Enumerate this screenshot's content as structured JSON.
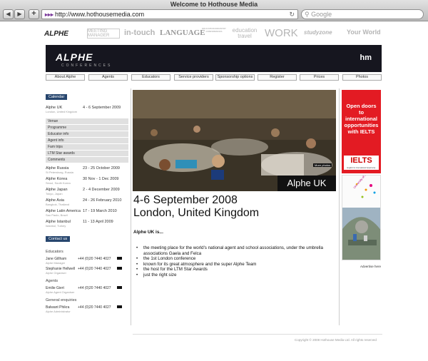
{
  "window": {
    "title": "Welcome to Hothouse Media"
  },
  "toolbar": {
    "back": "◀",
    "forward": "▶",
    "add": "+",
    "url": "http://www.hothousemedia.com",
    "search_placeholder": "Google",
    "reload": "↻"
  },
  "brands": [
    "ALPHE",
    "MEETING MANAGER",
    "in-touch",
    "LANGUAGE",
    "EDUCATION INDUSTRY CONFERENCES",
    "education travel",
    "WORK",
    "studyzone",
    "Your World"
  ],
  "banner": {
    "logo": "ALPHE",
    "sub": "CONFERENCES",
    "mark": "hm"
  },
  "menu": [
    "About Alphe",
    "Agents",
    "Educators",
    "Service providers",
    "Sponsorship options",
    "Register",
    "Prices",
    "Photos"
  ],
  "sidebar": {
    "calendar_tab": "Calendar",
    "current": {
      "name": "Alphe UK",
      "sub": "London, United Kingdom",
      "date": "4 - 6 September 2009"
    },
    "submenu": [
      "Venue",
      "Programme",
      "Educator info",
      "Agent info",
      "Fam trips",
      "LTM Star awards",
      "Comments"
    ],
    "events": [
      {
        "name": "Alphe Russia",
        "sub": "St Petersburg, Russia",
        "date": "23 - 25 October 2009"
      },
      {
        "name": "Alphe Korea",
        "sub": "Seoul, South Korea",
        "date": "30 Nov - 1 Dec 2009"
      },
      {
        "name": "Alphe Japan",
        "sub": "Tokyo, Japan",
        "date": "2 - 4 December 2009"
      },
      {
        "name": "Alphe Asia",
        "sub": "Bangkok, Thailand",
        "date": "24 - 26 February 2010"
      },
      {
        "name": "Alphe Latin America",
        "sub": "Sao Paulo, Brazil",
        "date": "17 - 19 March 2010"
      },
      {
        "name": "Alphe Istanbul",
        "sub": "Istanbul, Turkey",
        "date": "11 - 13 April 2009"
      }
    ],
    "contact_tab": "Contact us",
    "groups": [
      {
        "title": "Educators",
        "people": [
          {
            "name": "Jane Gillham",
            "role": "Alphe Manager",
            "phone": "+44 (0)20 7440 4027"
          },
          {
            "name": "Stephanie Hellwell",
            "role": "Alphe Organiser",
            "phone": "+44 (0)20 7440 4027"
          }
        ]
      },
      {
        "title": "Agents",
        "people": [
          {
            "name": "Emilie Giert",
            "role": "Alphe Agent Organiser",
            "phone": "+44 (0)20 7440 4027"
          }
        ]
      },
      {
        "title": "General enquiries",
        "people": [
          {
            "name": "Balwant Phikra",
            "role": "Alphe Administrator",
            "phone": "+44 (0)20 7440 4027"
          }
        ]
      }
    ]
  },
  "hero": {
    "caption": "Alphe UK",
    "more": "More photos"
  },
  "content": {
    "date": "4-6 September 2008",
    "place": "London, United Kingdom",
    "intro": "Alphe UK is...",
    "bullets": [
      "the meeting place for the world's national agent and school associations, under the umbrella associations Gaela and Felca",
      "the 1st London conference",
      "known for its great atmosphere and the super Alphe Team",
      "the host for the LTM Star Awards",
      "just the right size"
    ]
  },
  "ads": {
    "ad1_text": "Open doors to international opportunities with IELTS",
    "ad1_logo": "IELTS",
    "ad1_logo_sub": "English for International Opportunity",
    "ad2_text": "University of the Arts London",
    "advertise": "Advertise here"
  },
  "footer": {
    "copyright": "Copyright © 2008 Hothouse Media Ltd. All rights reserved"
  },
  "colors": {
    "banner": "#16161f",
    "tab": "#27466e",
    "ielts_red": "#e31b23"
  }
}
